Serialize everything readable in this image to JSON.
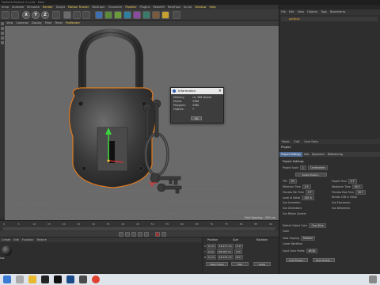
{
  "window": {
    "title": "Padlock-Padlock 11.c4d - Main"
  },
  "menu": [
    "Snap",
    "Animate",
    "Simulate",
    "Render",
    "Sculpt",
    "Motion Tracker",
    "MoGraph",
    "Character",
    "Pipeline",
    "Plugins",
    "Redshift",
    "RealFlow",
    "Script",
    "Window",
    "Help"
  ],
  "menu_highlight": [
    3,
    5,
    8,
    13,
    14
  ],
  "toolbar": {
    "x": "X",
    "y": "Y",
    "z": "Z"
  },
  "viewport_menu": [
    "View",
    "Cameras",
    "Display",
    "Filter",
    "Panel",
    "ProRender"
  ],
  "viewport": {
    "status": "Grid Spacing : 100 cm"
  },
  "info_dialog": {
    "title": "Information",
    "rows": [
      {
        "k": "Memory:",
        "v": "ca. 368 kbytes"
      },
      {
        "k": "Points:",
        "v": "3388"
      },
      {
        "k": "Polygons:",
        "v": "3360"
      },
      {
        "k": "Objects:",
        "v": "7"
      }
    ],
    "ok_label": "OK"
  },
  "right_panel": {
    "menu": [
      "File",
      "Edit",
      "View",
      "Objects",
      "Tags",
      "Bookmarks"
    ],
    "object_name": "padlock",
    "attr_tabs": [
      "Mode",
      "Edit",
      "User Data"
    ],
    "attr_title": "Project",
    "project_tabs": [
      "Project Settings",
      "Info",
      "Dynamics",
      "Referencing"
    ],
    "section": "Project Settings",
    "fields": [
      {
        "label": "Project Scale",
        "value": "1",
        "unit": "Centimeters"
      },
      {
        "label": "FPS",
        "value": "30",
        "label2": "Project Time",
        "value2": "0 F"
      },
      {
        "label": "Minimum Time",
        "value": "0 F",
        "label2": "Maximum Time",
        "value2": "90 F"
      },
      {
        "label": "Preview Min Time",
        "value": "0 F",
        "label2": "Preview Max Time",
        "value2": "90 F"
      },
      {
        "label": "Level of Detail",
        "value": "100 %",
        "label2": "Render LOD in Editor",
        "value2": ""
      },
      {
        "label": "Use Animation",
        "value": "",
        "label2": "Use Expression",
        "value2": ""
      },
      {
        "label": "Use Generators",
        "value": "",
        "label2": "Use Deformers",
        "value2": ""
      },
      {
        "label": "Use Motion System",
        "value": ""
      }
    ],
    "scale_button": "Scale Project...",
    "lower_fields": [
      {
        "label": "Default Object Color",
        "value": "Gray-Blue"
      },
      {
        "label": "Color",
        "value": ""
      },
      {
        "label": "View Clipping",
        "value": "Medium"
      },
      {
        "label": "Linear Workflow",
        "value": ""
      },
      {
        "label": "Input Color Profile",
        "value": "sRGB"
      }
    ],
    "load_preset": "Load Preset...",
    "save_preset": "Save Preset..."
  },
  "timeline": {
    "ticks": [
      "0",
      "5",
      "10",
      "15",
      "20",
      "25",
      "30",
      "35",
      "40",
      "45",
      "50",
      "55",
      "60",
      "65",
      "70",
      "75",
      "80",
      "85",
      "90"
    ]
  },
  "material_manager": {
    "menu": [
      "Create",
      "Edit",
      "Function",
      "Texture"
    ],
    "material_label": "Mat"
  },
  "coordinates": {
    "headers": [
      "Position",
      "Size",
      "Rotation"
    ],
    "rows": [
      {
        "axis": "X",
        "pos": "0 cm",
        "size": "73.077 cm",
        "rot": "H 0°"
      },
      {
        "axis": "Y",
        "pos": "0 cm",
        "size": "98.005 cm",
        "rot": "P 0°"
      },
      {
        "axis": "Z",
        "pos": "0 cm",
        "size": "23.279 cm",
        "rot": "B 0°"
      }
    ],
    "mode1": "Object (Rel)",
    "mode2": "Size",
    "apply": "Apply"
  }
}
